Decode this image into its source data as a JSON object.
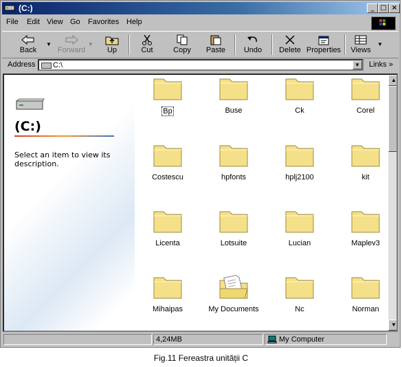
{
  "window": {
    "title": "(C:)"
  },
  "menu": [
    "File",
    "Edit",
    "View",
    "Go",
    "Favorites",
    "Help"
  ],
  "toolbar": {
    "back": "Back",
    "forward": "Forward",
    "up": "Up",
    "cut": "Cut",
    "copy": "Copy",
    "paste": "Paste",
    "undo": "Undo",
    "delete": "Delete",
    "properties": "Properties",
    "views": "Views"
  },
  "address": {
    "label": "Address",
    "value": "C:\\",
    "links": "Links"
  },
  "leftpane": {
    "title": "(C:)",
    "description": "Select an item to view its description."
  },
  "folders": [
    "Bp",
    "Buse",
    "Ck",
    "Corel",
    "Costescu",
    "hpfonts",
    "hplj2100",
    "kit",
    "Licenta",
    "Lotsuite",
    "Lucian",
    "Maplev3",
    "Mihaipas",
    "My Documents",
    "Nc",
    "Norman"
  ],
  "status": {
    "size": "4,24MB",
    "location": "My Computer"
  },
  "caption": "Fig.11 Fereastra unității C",
  "colors": {
    "titlebar": "#0a246a",
    "folder": "#f5e08a"
  }
}
